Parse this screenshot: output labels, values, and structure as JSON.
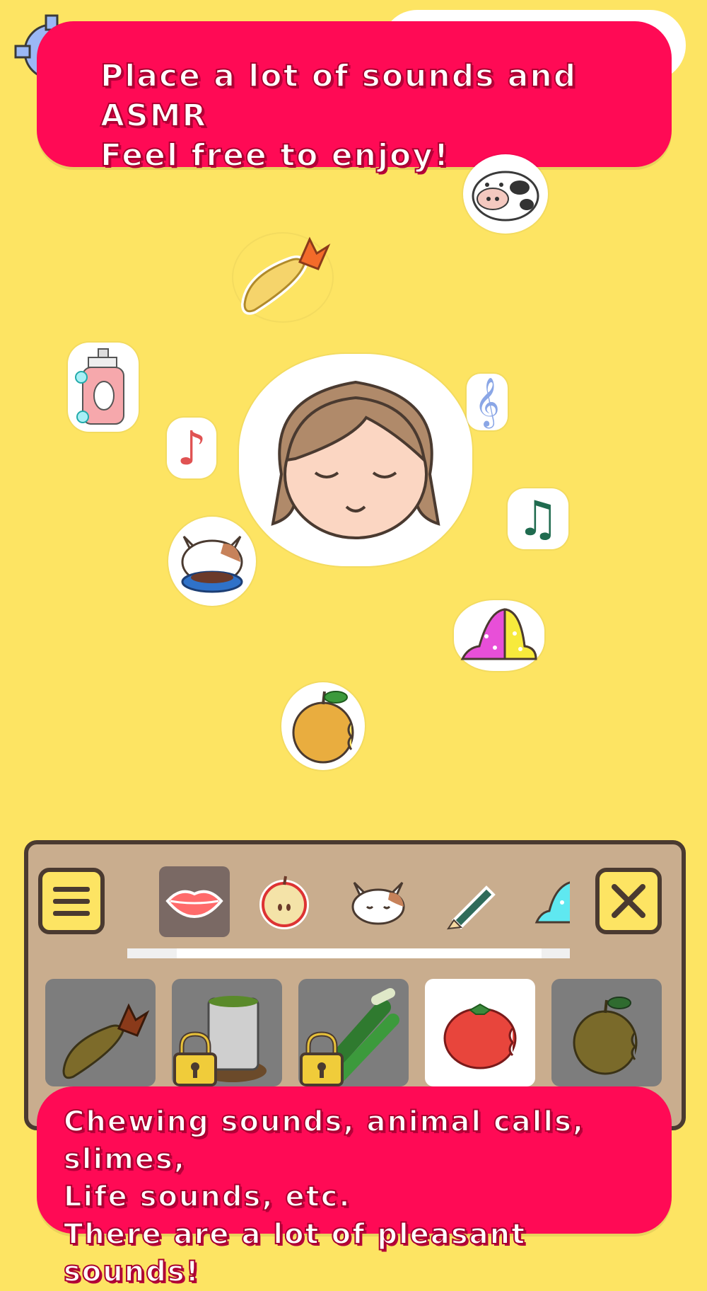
{
  "banners": {
    "top": {
      "line1": "Place a lot of sounds and ASMR",
      "line2": "Feel free to enjoy!"
    },
    "bottom": {
      "line1": "Chewing sounds, animal calls, slimes,",
      "line2": "Life sounds, etc.",
      "line3": "There are a lot of pleasant sounds!"
    }
  },
  "scene": {
    "stickers": [
      "settings-gear-icon",
      "cow-icon",
      "shrimp-tempura-icon",
      "shampoo-bottle-icon",
      "treble-clef-icon",
      "red-eighth-note-icon",
      "girl-face-icon",
      "green-beamed-notes-icon",
      "cat-eating-icon",
      "slime-icon",
      "bitten-apple-icon"
    ]
  },
  "toolbar": {
    "menu_icon": "hamburger-menu-icon",
    "close_icon": "close-x-icon",
    "categories": [
      "lips-icon",
      "apple-icon",
      "cat-face-icon",
      "pencil-icon",
      "slime-partial-icon"
    ],
    "selected_category": "lips-icon",
    "scroll_position": 0.13
  },
  "items": [
    {
      "icon": "shrimp-tempura-icon",
      "locked": false
    },
    {
      "icon": "green-tea-cup-icon",
      "locked": true
    },
    {
      "icon": "green-onion-icon",
      "locked": true
    },
    {
      "icon": "tomato-icon",
      "locked": false,
      "active": true
    },
    {
      "icon": "asian-pear-icon",
      "locked": false
    }
  ],
  "colors": {
    "background": "#fde463",
    "banner": "#ff0a55",
    "panel": "#c9ad8e",
    "panel_border": "#4a3a30"
  }
}
